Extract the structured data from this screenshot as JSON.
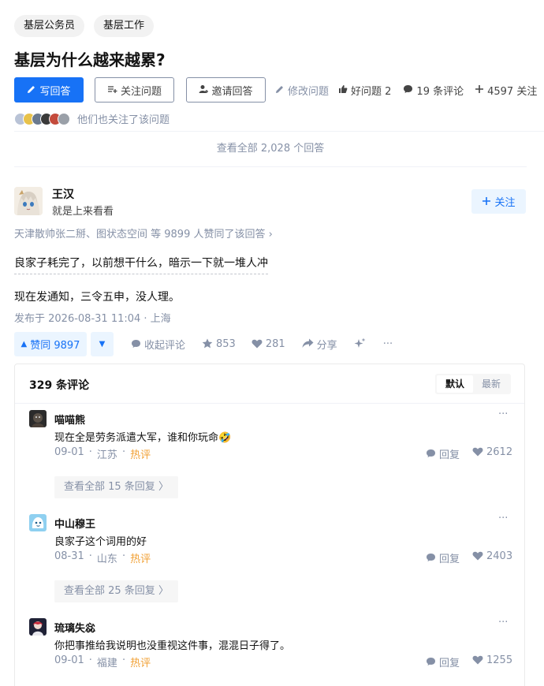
{
  "question": {
    "topics": [
      "基层公务员",
      "基层工作"
    ],
    "title": "基层为什么越来越累?",
    "write_answer": "写回答",
    "follow_question": "关注问题",
    "invite_answer": "邀请回答",
    "edit_question": "修改问题",
    "good_question": "好问题 2",
    "comments": "19 条评论",
    "followers": "4597 关注",
    "followers_note": "他们也关注了该问题",
    "view_all_answers": "查看全部 2,028 个回答"
  },
  "answer": {
    "author_name": "王汉",
    "author_bio": "就是上来看看",
    "follow_label": "关注",
    "voters": "天津散帅张二掰、图状态空间 等 9899 人赞同了该回答 ›",
    "paragraphs": [
      "良家子耗完了，以前想干什么，暗示一下就一堆人冲",
      "现在发通知，三令五申，没人理。"
    ],
    "published": "发布于 2026-08-31 11:04 · 上海",
    "vote_up": "赞同 9897",
    "collapse_comments": "收起评论",
    "stars": "853",
    "likes": "281",
    "share": "分享",
    "more": "···"
  },
  "comments_panel": {
    "count": "329 条评论",
    "sort_default": "默认",
    "sort_latest": "最新",
    "items": [
      {
        "name": "喵喵熊",
        "text": "现在全是劳务派遣大军，谁和你玩命🤣",
        "date": "09-01",
        "loc": "江苏",
        "tag": "热评",
        "reply": "回复",
        "likes": "2612",
        "expand": "查看全部 15 条回复 〉",
        "more": "···"
      },
      {
        "name": "中山穆王",
        "text": "良家子这个词用的好",
        "date": "08-31",
        "loc": "山东",
        "tag": "热评",
        "reply": "回复",
        "likes": "2403",
        "expand": "查看全部 25 条回复 〉",
        "more": "···"
      },
      {
        "name": "琉璃失惢",
        "text": "你把事推给我说明也没重视这件事，混混日子得了。",
        "date": "09-01",
        "loc": "福建",
        "tag": "热评",
        "reply": "回复",
        "likes": "1255",
        "more": "···"
      }
    ]
  },
  "colors": {
    "brand": "#1772f6",
    "hot": "#f1a034",
    "muted": "#8590a6"
  }
}
